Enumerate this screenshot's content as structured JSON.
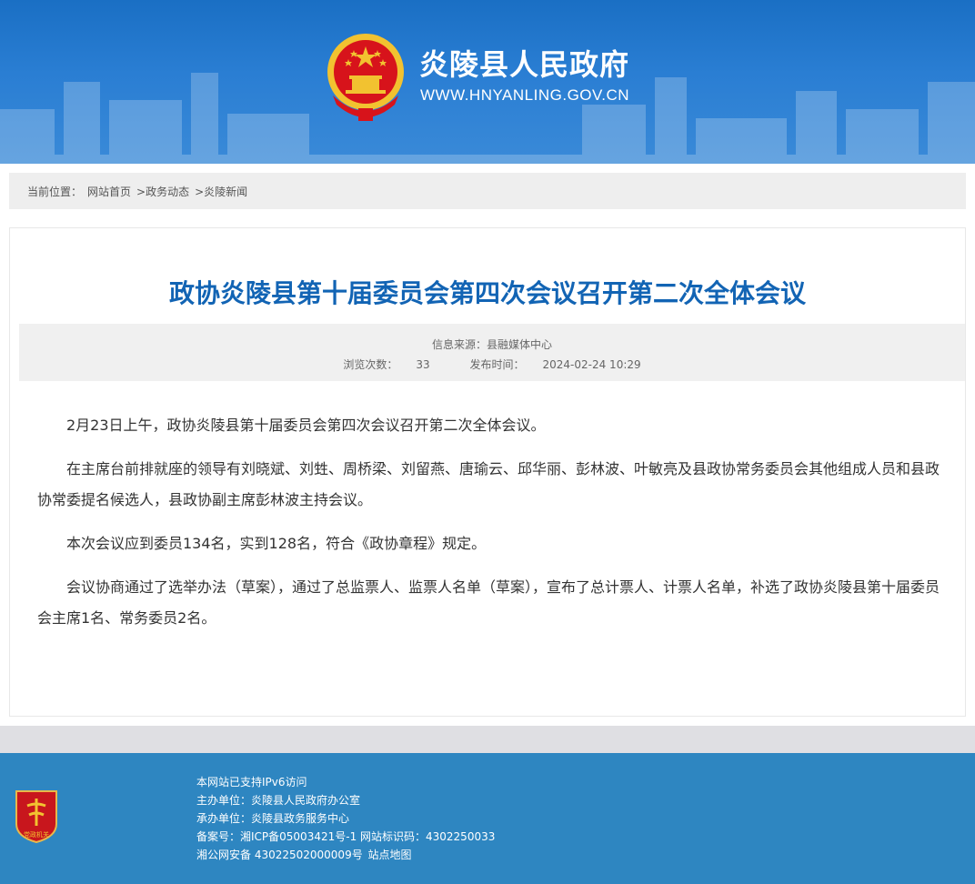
{
  "header": {
    "site_title": "炎陵县人民政府",
    "site_url": "WWW.HNYANLING.GOV.CN"
  },
  "breadcrumb": {
    "prefix": "当前位置：",
    "items": [
      "网站首页",
      ">政务动态",
      ">炎陵新闻"
    ]
  },
  "article": {
    "title": "政协炎陵县第十届委员会第四次会议召开第二次全体会议",
    "source_label": "信息来源：县融媒体中心",
    "views_label": "浏览次数：",
    "views": "33",
    "published_label": "发布时间：",
    "published": "2024-02-24 10:29",
    "paragraphs": [
      "2月23日上午，政协炎陵县第十届委员会第四次会议召开第二次全体会议。",
      "在主席台前排就座的领导有刘晓斌、刘甡、周桥梁、刘留燕、唐瑜云、邱华丽、彭林波、叶敏亮及县政协常务委员会其他组成人员和县政协常委提名候选人，县政协副主席彭林波主持会议。",
      "本次会议应到委员134名，实到128名，符合《政协章程》规定。",
      "会议协商通过了选举办法（草案），通过了总监票人、监票人名单（草案），宣布了总计票人、计票人名单，补选了政协炎陵县第十届委员会主席1名、常务委员2名。"
    ]
  },
  "footer": {
    "ipv6": "本网站已支持IPv6访问",
    "sponsor": "主办单位：炎陵县人民政府办公室",
    "organizer": "承办单位：炎陵县政务服务中心",
    "icp": "备案号：湘ICP备05003421号-1 网站标识码：4302250033",
    "police_record": "湘公网安备 43022502000009号",
    "sitemap": "站点地图",
    "badge_text": "党政机关"
  },
  "colors": {
    "header_blue": "#1a6fc4",
    "title_blue": "#1264b4",
    "footer_blue": "#2e86c1",
    "emblem_red": "#d7131b",
    "emblem_gold": "#f2c230"
  }
}
